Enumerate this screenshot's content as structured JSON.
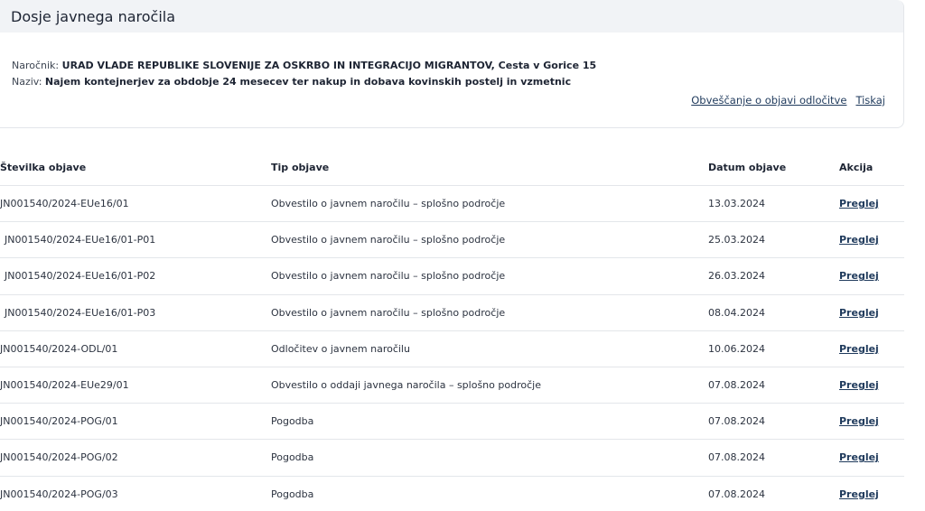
{
  "dossier": {
    "title": "Dosje javnega naročila",
    "client_label": "Naročnik:",
    "client_value": "URAD VLADE REPUBLIKE SLOVENIJE ZA OSKRBO IN INTEGRACIJO MIGRANTOV, Cesta v Gorice 15",
    "name_label": "Naziv:",
    "name_value": "Najem kontejnerjev za obdobje 24 mesecev ter nakup in dobava kovinskih postelj in vzmetnic",
    "links": {
      "notify": "Obveščanje o objavi odločitve",
      "print": "Tiskaj"
    }
  },
  "table": {
    "headers": {
      "number": "Številka objave",
      "type": "Tip objave",
      "date": "Datum objave",
      "action": "Akcija"
    },
    "rows": [
      {
        "number": "JN001540/2024-EUe16/01",
        "type": "Obvestilo o javnem naročilu – splošno področje",
        "date": "13.03.2024",
        "action": "Preglej"
      },
      {
        "number": "JN001540/2024-EUe16/01-P01",
        "type": "Obvestilo o javnem naročilu – splošno področje",
        "date": "25.03.2024",
        "action": "Preglej"
      },
      {
        "number": "JN001540/2024-EUe16/01-P02",
        "type": "Obvestilo o javnem naročilu – splošno področje",
        "date": "26.03.2024",
        "action": "Preglej"
      },
      {
        "number": "JN001540/2024-EUe16/01-P03",
        "type": "Obvestilo o javnem naročilu – splošno področje",
        "date": "08.04.2024",
        "action": "Preglej"
      },
      {
        "number": "JN001540/2024-ODL/01",
        "type": "Odločitev o javnem naročilu",
        "date": "10.06.2024",
        "action": "Preglej"
      },
      {
        "number": "JN001540/2024-EUe29/01",
        "type": "Obvestilo o oddaji javnega naročila – splošno področje",
        "date": "07.08.2024",
        "action": "Preglej"
      },
      {
        "number": "JN001540/2024-POG/01",
        "type": "Pogodba",
        "date": "07.08.2024",
        "action": "Preglej"
      },
      {
        "number": "JN001540/2024-POG/02",
        "type": "Pogodba",
        "date": "07.08.2024",
        "action": "Preglej"
      },
      {
        "number": "JN001540/2024-POG/03",
        "type": "Pogodba",
        "date": "07.08.2024",
        "action": "Preglej"
      }
    ]
  }
}
